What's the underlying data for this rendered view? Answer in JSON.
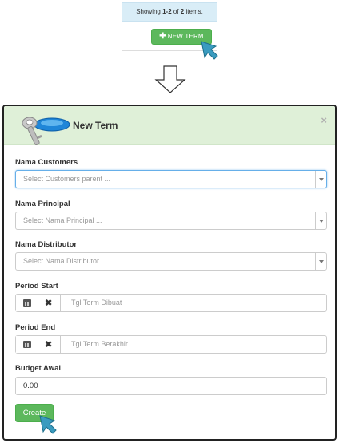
{
  "summary": {
    "prefix": "Showing ",
    "range": "1-2",
    "of": " of ",
    "total": "2",
    "suffix": " items."
  },
  "new_term_button": {
    "icon": "plus-icon",
    "label": "NEW TERM"
  },
  "modal": {
    "title": "New Term",
    "icon": "term-key-icon",
    "close_label": "×",
    "fields": {
      "customers": {
        "label": "Nama Customers",
        "placeholder": "Select Customers parent ..."
      },
      "principal": {
        "label": "Nama Principal",
        "placeholder": "Select Nama Principal ..."
      },
      "distributor": {
        "label": "Nama Distributor",
        "placeholder": "Select Nama Distributor ..."
      },
      "period_start": {
        "label": "Period Start",
        "placeholder": "Tgl Term Dibuat"
      },
      "period_end": {
        "label": "Period End",
        "placeholder": "Tgl Term Berakhir"
      },
      "budget_awal": {
        "label": "Budget Awal",
        "value": "0.00"
      }
    },
    "create_label": "Create"
  },
  "colors": {
    "success": "#5cb85c",
    "header_bg": "#dff0d8",
    "info_bg": "#d9edf7",
    "focus": "#66afe9",
    "cursor": "#3a9bbf"
  }
}
